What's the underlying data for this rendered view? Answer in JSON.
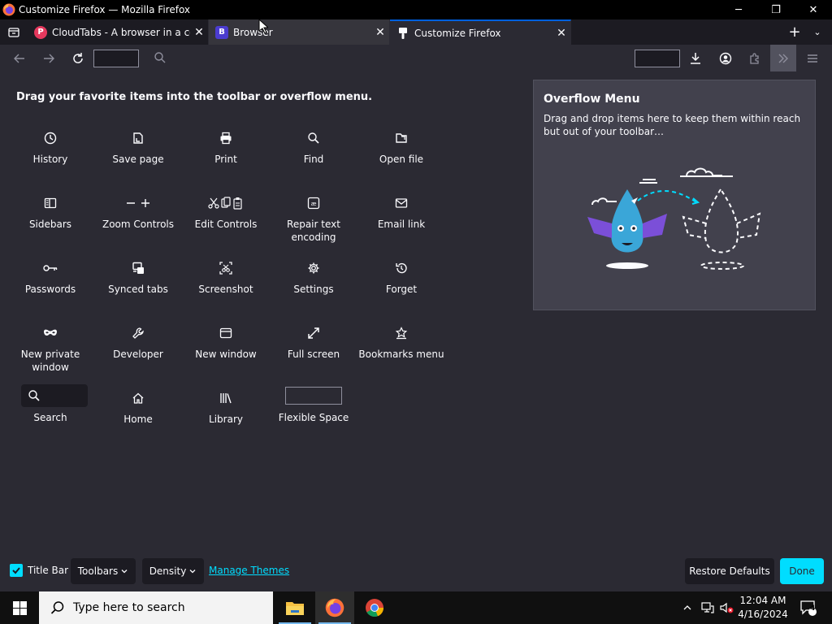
{
  "window": {
    "title": "Customize Firefox — Mozilla Firefox",
    "controls": {
      "minimize": "─",
      "restore": "❐",
      "close": "✕"
    }
  },
  "tabs": [
    {
      "label": "CloudTabs - A browser in a computer",
      "favicon_letter": "P",
      "favicon_color": "#e5385d",
      "state": "normal"
    },
    {
      "label": "Browser",
      "favicon_letter": "B",
      "favicon_color": "#4b3ccf",
      "state": "hover"
    },
    {
      "label": "Customize Firefox",
      "favicon_letter": "",
      "favicon_color": "#fbfbfe",
      "state": "selected"
    }
  ],
  "tabstrip": {
    "close_glyph": "✕",
    "newtab_glyph": "+",
    "list_all_glyph": "⌄"
  },
  "customize": {
    "heading": "Drag your favorite items into the toolbar or overflow menu.",
    "items": [
      {
        "label": "History",
        "icon": "clock-icon"
      },
      {
        "label": "Save page",
        "icon": "save-page-icon"
      },
      {
        "label": "Print",
        "icon": "printer-icon"
      },
      {
        "label": "Find",
        "icon": "magnifier-icon"
      },
      {
        "label": "Open file",
        "icon": "open-file-icon"
      },
      {
        "label": "Sidebars",
        "icon": "sidebar-icon"
      },
      {
        "label": "Zoom Controls",
        "icon": "zoom-icon"
      },
      {
        "label": "Edit Controls",
        "icon": "edit-controls-icon"
      },
      {
        "label": "Repair text encoding",
        "icon": "text-encoding-icon"
      },
      {
        "label": "Email link",
        "icon": "envelope-icon"
      },
      {
        "label": "Passwords",
        "icon": "key-icon"
      },
      {
        "label": "Synced tabs",
        "icon": "synced-tabs-icon"
      },
      {
        "label": "Screenshot",
        "icon": "screenshot-icon"
      },
      {
        "label": "Settings",
        "icon": "gear-icon"
      },
      {
        "label": "Forget",
        "icon": "forget-icon"
      },
      {
        "label": "New private window",
        "icon": "mask-icon"
      },
      {
        "label": "Developer",
        "icon": "wrench-icon"
      },
      {
        "label": "New window",
        "icon": "window-icon"
      },
      {
        "label": "Full screen",
        "icon": "fullscreen-icon"
      },
      {
        "label": "Bookmarks menu",
        "icon": "bookmark-star-icon"
      },
      {
        "label": "Search",
        "icon": "search-widget-icon"
      },
      {
        "label": "Home",
        "icon": "home-icon"
      },
      {
        "label": "Library",
        "icon": "library-icon"
      },
      {
        "label": "Flexible Space",
        "icon": "flexible-space-icon"
      }
    ]
  },
  "overflow_panel": {
    "title": "Overflow Menu",
    "description": "Drag and drop items here to keep them within reach but out of your toolbar…"
  },
  "footer": {
    "title_bar_label": "Title Bar",
    "title_bar_checked": true,
    "toolbars_label": "Toolbars",
    "density_label": "Density",
    "manage_themes_label": "Manage Themes",
    "restore_defaults_label": "Restore Defaults",
    "done_label": "Done"
  },
  "taskbar": {
    "search_placeholder": "Type here to search",
    "time": "12:04 AM",
    "date": "4/16/2024",
    "notification_count": "4"
  },
  "colors": {
    "accent": "#00ddff",
    "toolbar_bg": "#2b2a33",
    "frame_bg": "#1c1b22",
    "panel_bg": "#42414d"
  }
}
